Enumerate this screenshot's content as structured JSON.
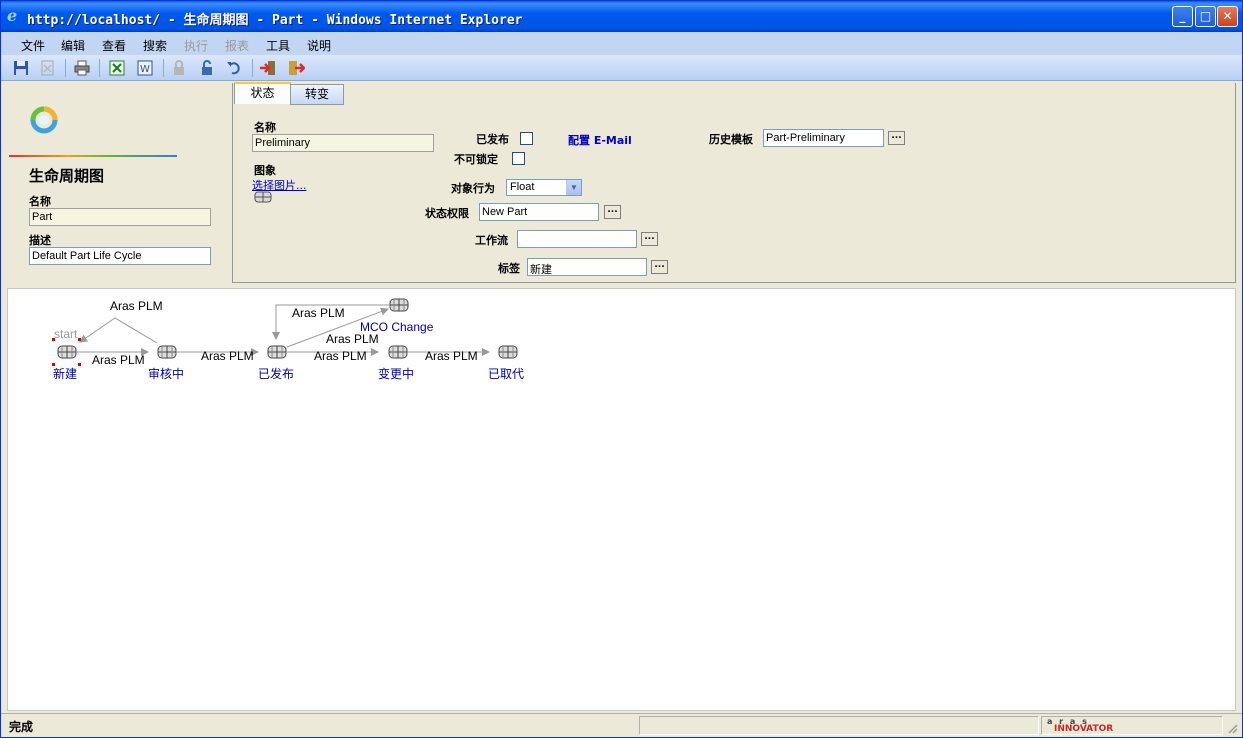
{
  "window": {
    "title": "http://localhost/ - 生命周期图 - Part - Windows Internet Explorer",
    "controls": [
      "minimize",
      "maximize",
      "close"
    ]
  },
  "menu": {
    "items": [
      {
        "label": "文件",
        "enabled": true
      },
      {
        "label": "编辑",
        "enabled": true
      },
      {
        "label": "查看",
        "enabled": true
      },
      {
        "label": "搜索",
        "enabled": true
      },
      {
        "label": "执行",
        "enabled": false
      },
      {
        "label": "报表",
        "enabled": false
      },
      {
        "label": "工具",
        "enabled": true
      },
      {
        "label": "说明",
        "enabled": true
      }
    ]
  },
  "toolbar": {
    "icons": [
      "save-icon",
      "discard-icon",
      "print-icon",
      "excel-export-icon",
      "word-export-icon",
      "lock-icon",
      "unlock-icon",
      "undo-icon",
      "promote-icon",
      "exit-icon"
    ]
  },
  "left": {
    "heading": "生命周期图",
    "name_label": "名称",
    "name_value": "Part",
    "desc_label": "描述",
    "desc_value": "Default Part Life Cycle"
  },
  "tabs": [
    {
      "label": "状态",
      "active": true
    },
    {
      "label": "转变",
      "active": false
    }
  ],
  "state_form": {
    "name_label": "名称",
    "name_value": "Preliminary",
    "image_label": "图象",
    "select_image_link": "选择图片...",
    "released_label": "已发布",
    "released_checked": false,
    "email_link": "配置 E-Mail",
    "not_lockable_label": "不可锁定",
    "not_lockable_checked": false,
    "object_behavior_label": "对象行为",
    "object_behavior_value": "Float",
    "state_permission_label": "状态权限",
    "state_permission_value": "New Part",
    "workflow_label": "工作流",
    "workflow_value": "",
    "tag_label": "标签",
    "tag_value": "新建",
    "history_template_label": "历史模板",
    "history_template_value": "Part-Preliminary",
    "ellipsis": "..."
  },
  "diagram": {
    "start_label": "start",
    "states": [
      {
        "id": "s1",
        "label": "新建"
      },
      {
        "id": "s2",
        "label": "审核中"
      },
      {
        "id": "s3",
        "label": "已发布"
      },
      {
        "id": "s4",
        "label": "变更中"
      },
      {
        "id": "s5",
        "label": "已取代"
      },
      {
        "id": "s6",
        "label": "MCO Change"
      }
    ],
    "transitions": [
      {
        "label": "Aras PLM"
      },
      {
        "label": "Aras PLM"
      },
      {
        "label": "Aras PLM"
      },
      {
        "label": "Aras PLM"
      },
      {
        "label": "Aras PLM"
      },
      {
        "label": "Aras PLM"
      },
      {
        "label": "Aras PLM"
      }
    ]
  },
  "status": {
    "text": "完成",
    "brand_top": "a r a s",
    "brand_bottom": "INNOVATOR"
  }
}
